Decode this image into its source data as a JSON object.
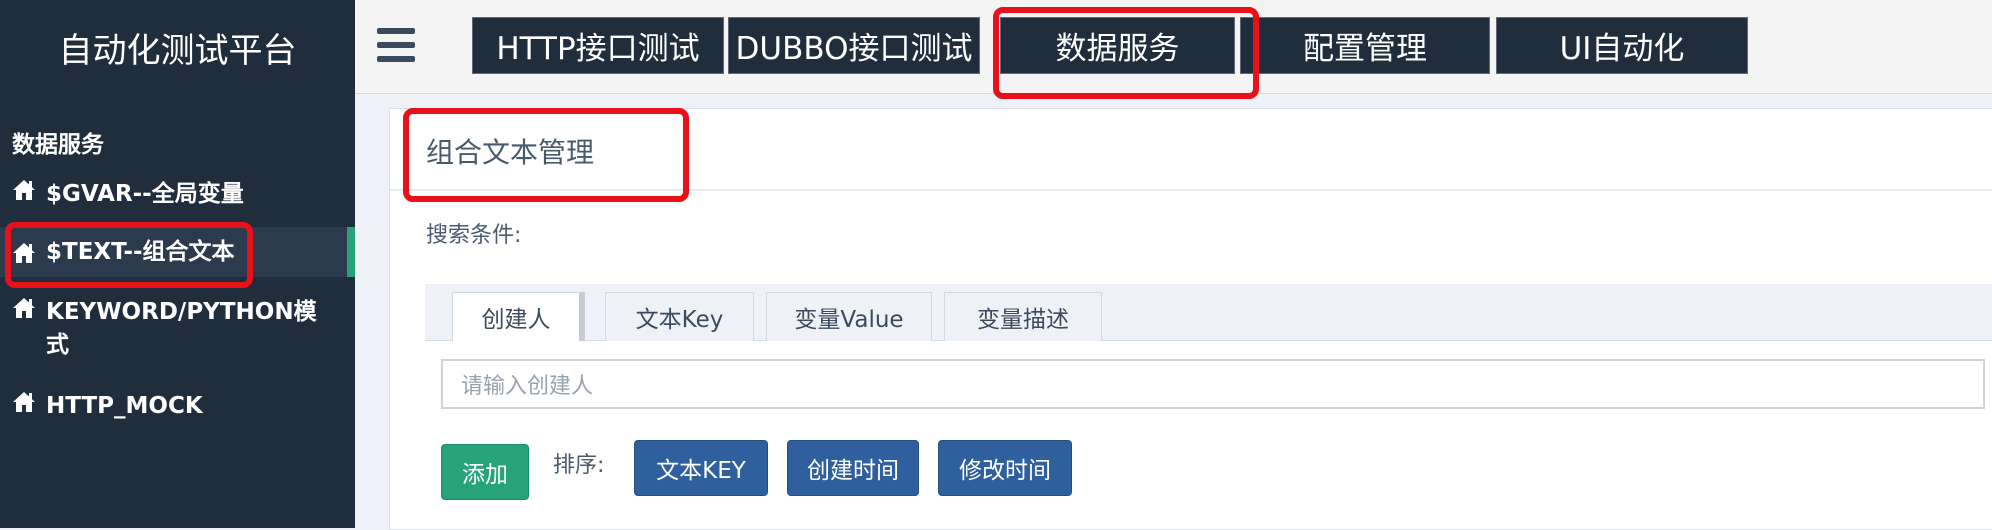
{
  "app": {
    "title": "自动化测试平台"
  },
  "sidebar": {
    "section_title": "数据服务",
    "items": [
      {
        "label": "$GVAR--全局变量",
        "icon": "home-icon"
      },
      {
        "label": "$TEXT--组合文本",
        "icon": "home-icon"
      },
      {
        "label": "KEYWORD/PYTHON模式",
        "icon": "home-icon"
      },
      {
        "label": "HTTP_MOCK",
        "icon": "home-icon"
      }
    ]
  },
  "header": {
    "menu_icon": "hamburger-menu-icon",
    "tabs": [
      {
        "label": "HTTP接口测试"
      },
      {
        "label": "DUBBO接口测试"
      },
      {
        "label": "数据服务"
      },
      {
        "label": "配置管理"
      },
      {
        "label": "UI自动化"
      }
    ]
  },
  "main": {
    "title": "组合文本管理",
    "search_label": "搜索条件:",
    "filter_tabs": [
      {
        "label": "创建人"
      },
      {
        "label": "文本Key"
      },
      {
        "label": "变量Value"
      },
      {
        "label": "变量描述"
      }
    ],
    "search_placeholder": "请输入创建人",
    "add_button": "添加",
    "sort_label": "排序:",
    "sort_buttons": [
      {
        "label": "文本KEY"
      },
      {
        "label": "创建时间"
      },
      {
        "label": "修改时间"
      }
    ]
  },
  "colors": {
    "sidebar_bg": "#1f2d3d",
    "accent_green": "#27a37a",
    "button_blue": "#2f5f9c",
    "highlight_red": "#e8111a"
  }
}
